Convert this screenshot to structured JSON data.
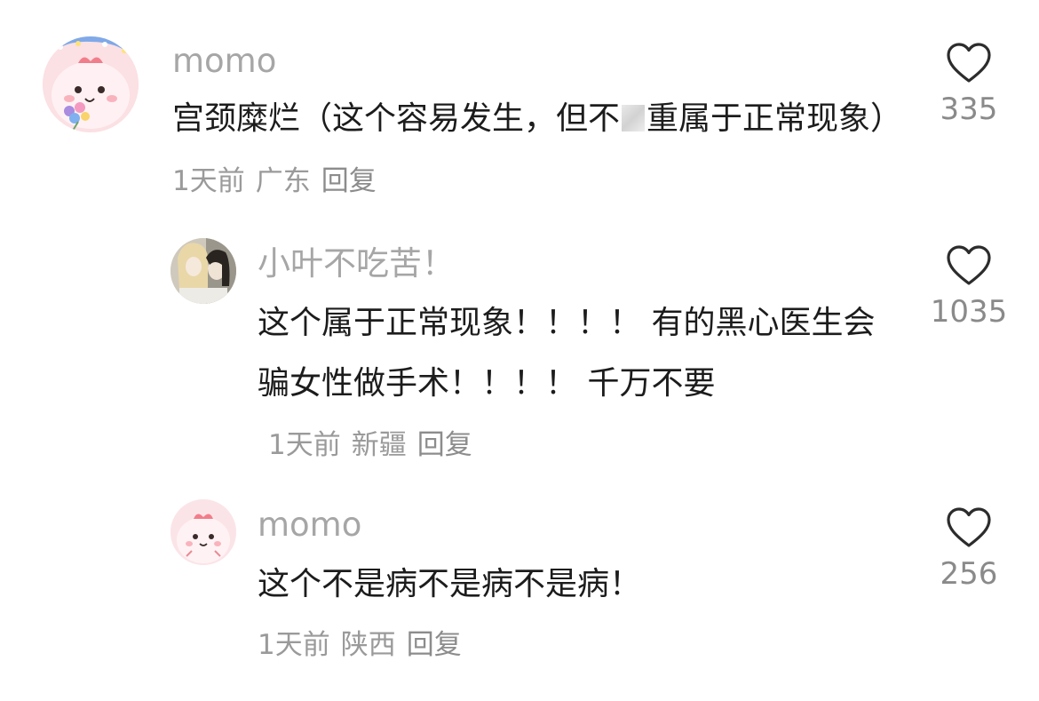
{
  "comments": [
    {
      "username": "momo",
      "text_before_censor": "宫颈糜烂（这个容易发生，但不",
      "text_after_censor": "重属于正常现象）",
      "time": "1天前",
      "location": "广东",
      "reply_label": "回复",
      "likes": "335"
    },
    {
      "username": "小叶不吃苦！",
      "text": "这个属于正常现象！！！！ 有的黑心医生会骗女性做手术！！！！ 千万不要",
      "time": "1天前",
      "location": "新疆",
      "reply_label": "回复",
      "likes": "1035"
    },
    {
      "username": "momo",
      "text": "这个不是病不是病不是病！",
      "time": "1天前",
      "location": "陕西",
      "reply_label": "回复",
      "likes": "256"
    }
  ],
  "icons": {
    "like": "heart-outline-icon"
  },
  "colors": {
    "username": "#a6a6a6",
    "meta": "#9a9a9a",
    "like_count": "#8a8a8a"
  }
}
